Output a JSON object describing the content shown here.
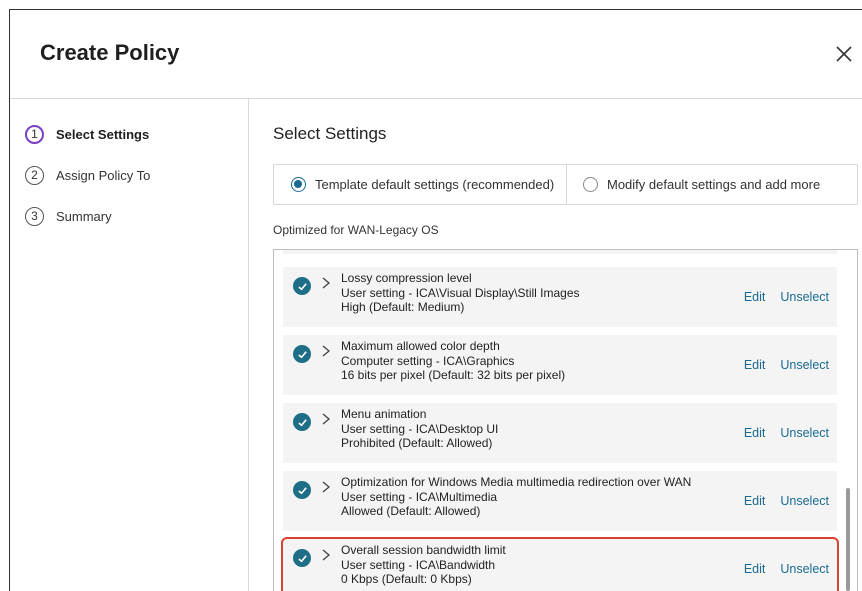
{
  "dialog": {
    "title": "Create Policy"
  },
  "steps": [
    {
      "number": "1",
      "label": "Select Settings",
      "active": true
    },
    {
      "number": "2",
      "label": "Assign Policy To",
      "active": false
    },
    {
      "number": "3",
      "label": "Summary",
      "active": false
    }
  ],
  "main": {
    "section_title": "Select Settings",
    "radio_options": [
      {
        "label": "Template default settings (recommended)",
        "checked": true
      },
      {
        "label": "Modify default settings and add more",
        "checked": false
      }
    ],
    "optimized_label": "Optimized for WAN-Legacy OS",
    "settings": [
      {
        "name": "Lossy compression level",
        "path": "User setting - ICA\\Visual Display\\Still Images",
        "value": "High (Default: Medium)",
        "edit": "Edit",
        "unselect": "Unselect"
      },
      {
        "name": "Maximum allowed color depth",
        "path": "Computer setting - ICA\\Graphics",
        "value": "16 bits per pixel (Default: 32 bits per pixel)",
        "edit": "Edit",
        "unselect": "Unselect"
      },
      {
        "name": "Menu animation",
        "path": "User setting - ICA\\Desktop UI",
        "value": "Prohibited (Default: Allowed)",
        "edit": "Edit",
        "unselect": "Unselect"
      },
      {
        "name": "Optimization for Windows Media multimedia redirection over WAN",
        "path": "User setting - ICA\\Multimedia",
        "value": "Allowed (Default: Allowed)",
        "edit": "Edit",
        "unselect": "Unselect"
      },
      {
        "name": "Overall session bandwidth limit",
        "path": "User setting - ICA\\Bandwidth",
        "value": "0 Kbps (Default: 0 Kbps)",
        "edit": "Edit",
        "unselect": "Unselect"
      }
    ]
  },
  "colors": {
    "accent": "#1a6b8f",
    "check_bg": "#1f6e87",
    "active_step": "#7b3fc4",
    "highlight": "#d9412f"
  },
  "icons": {
    "close": "close-icon",
    "check": "checkmark-icon",
    "expand": "chevron-right-icon"
  }
}
